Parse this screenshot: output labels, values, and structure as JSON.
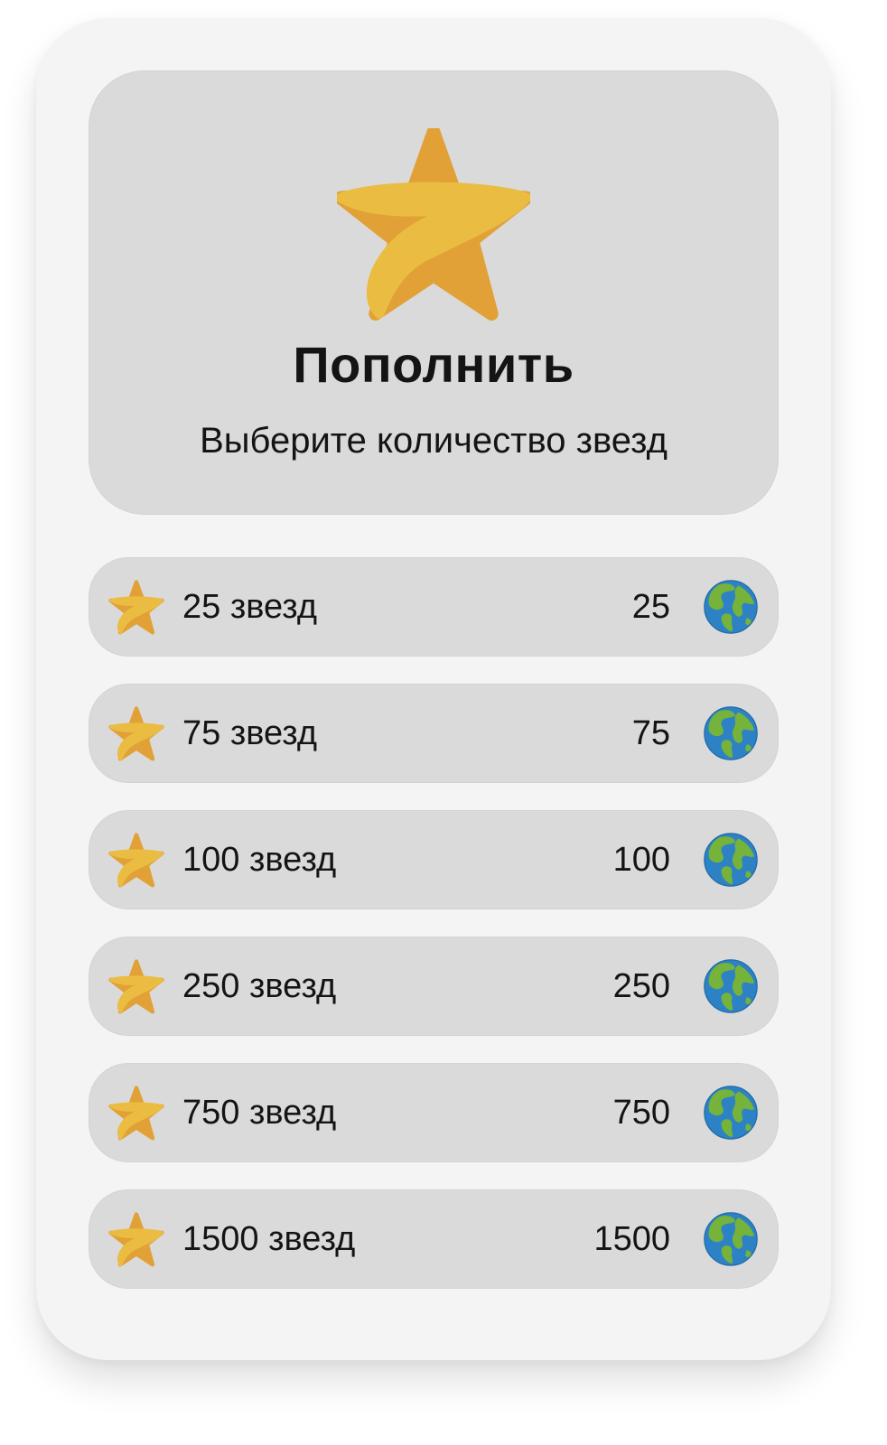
{
  "header": {
    "title": "Пополнить",
    "subtitle": "Выберите количество звезд",
    "icon": "star-icon"
  },
  "options": [
    {
      "label": "25 звезд",
      "price": "25",
      "icon": "star-icon",
      "currency_icon": "globe-icon"
    },
    {
      "label": "75 звезд",
      "price": "75",
      "icon": "star-icon",
      "currency_icon": "globe-icon"
    },
    {
      "label": "100 звезд",
      "price": "100",
      "icon": "star-icon",
      "currency_icon": "globe-icon"
    },
    {
      "label": "250 звезд",
      "price": "250",
      "icon": "star-icon",
      "currency_icon": "globe-icon"
    },
    {
      "label": "750 звезд",
      "price": "750",
      "icon": "star-icon",
      "currency_icon": "globe-icon"
    },
    {
      "label": "1500 звезд",
      "price": "1500",
      "icon": "star-icon",
      "currency_icon": "globe-icon"
    }
  ],
  "colors": {
    "panel_bg": "#f4f4f4",
    "card_bg": "#dadada",
    "star_light": "#eabd42",
    "star_dark": "#e1a136",
    "globe_ocean": "#2d82c6",
    "globe_land": "#75b33a"
  }
}
